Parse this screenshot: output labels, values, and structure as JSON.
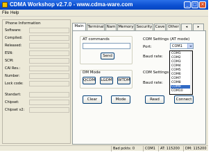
{
  "window": {
    "title": "CDMA Workshop v2.7.0   -   www.cdma-ware.com",
    "controls": [
      "_",
      "□",
      "×"
    ]
  },
  "menu": [
    "File",
    "Help"
  ],
  "phone_info": {
    "title": "Phone Information",
    "rows": [
      {
        "label": "Software:",
        "value": ""
      },
      {
        "label": "Compiled:",
        "value": ""
      },
      {
        "label": "Released:",
        "value": ""
      },
      {
        "label": "ESN:",
        "value": ""
      },
      {
        "label": "SCM:",
        "value": ""
      },
      {
        "label": "CAI Rev.:",
        "value": ""
      },
      {
        "label": "Number:",
        "value": ""
      },
      {
        "label": "Lock code:",
        "value": ""
      }
    ],
    "rows2": [
      {
        "label": "Standart:",
        "value": ""
      },
      {
        "label": "Chipset:",
        "value": ""
      },
      {
        "label": "Chipset v2:",
        "value": ""
      }
    ]
  },
  "tabs": [
    "Main",
    "Terminal",
    "Nam",
    "Memory",
    "Security",
    "Cave",
    "Other"
  ],
  "main": {
    "at_label": "AT commands",
    "at_value": "",
    "send": "Send",
    "dm_label": "DM Mode",
    "dm_buttons": [
      "QCDM",
      "LGDM",
      "WTDM"
    ],
    "clear": "Clear",
    "mode": "Mode",
    "read": "Read",
    "connect": "Connect",
    "com_label": "COM Settings (AT mode)",
    "port_label": "Port:",
    "port_value": "COM1",
    "baud_label": "Baud rate:",
    "com_label2": "COM Settings",
    "baud_label2": "Baud rate:"
  },
  "port_options": [
    "COM1",
    "COM2",
    "COM3",
    "COM4",
    "COM5",
    "COM6",
    "COM7",
    "COM8",
    "COM9",
    "COM10"
  ],
  "port_selected": "COM9",
  "status": {
    "bad_packets": "Bad pckts: 0",
    "com": "COM1",
    "at": "AT: 115200",
    "dm": "DM: 115200"
  }
}
